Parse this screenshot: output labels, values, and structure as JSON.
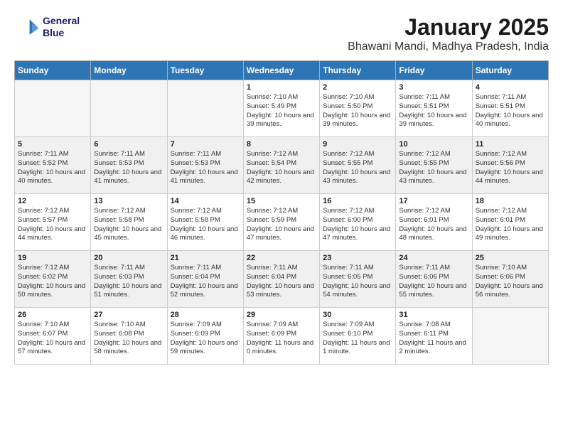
{
  "header": {
    "logo_line1": "General",
    "logo_line2": "Blue",
    "month": "January 2025",
    "location": "Bhawani Mandi, Madhya Pradesh, India"
  },
  "weekdays": [
    "Sunday",
    "Monday",
    "Tuesday",
    "Wednesday",
    "Thursday",
    "Friday",
    "Saturday"
  ],
  "weeks": [
    [
      {
        "day": "",
        "text": "",
        "empty": true
      },
      {
        "day": "",
        "text": "",
        "empty": true
      },
      {
        "day": "",
        "text": "",
        "empty": true
      },
      {
        "day": "1",
        "text": "Sunrise: 7:10 AM\nSunset: 5:49 PM\nDaylight: 10 hours\nand 39 minutes."
      },
      {
        "day": "2",
        "text": "Sunrise: 7:10 AM\nSunset: 5:50 PM\nDaylight: 10 hours\nand 39 minutes."
      },
      {
        "day": "3",
        "text": "Sunrise: 7:11 AM\nSunset: 5:51 PM\nDaylight: 10 hours\nand 39 minutes."
      },
      {
        "day": "4",
        "text": "Sunrise: 7:11 AM\nSunset: 5:51 PM\nDaylight: 10 hours\nand 40 minutes."
      }
    ],
    [
      {
        "day": "5",
        "text": "Sunrise: 7:11 AM\nSunset: 5:52 PM\nDaylight: 10 hours\nand 40 minutes."
      },
      {
        "day": "6",
        "text": "Sunrise: 7:11 AM\nSunset: 5:53 PM\nDaylight: 10 hours\nand 41 minutes."
      },
      {
        "day": "7",
        "text": "Sunrise: 7:11 AM\nSunset: 5:53 PM\nDaylight: 10 hours\nand 41 minutes."
      },
      {
        "day": "8",
        "text": "Sunrise: 7:12 AM\nSunset: 5:54 PM\nDaylight: 10 hours\nand 42 minutes."
      },
      {
        "day": "9",
        "text": "Sunrise: 7:12 AM\nSunset: 5:55 PM\nDaylight: 10 hours\nand 43 minutes."
      },
      {
        "day": "10",
        "text": "Sunrise: 7:12 AM\nSunset: 5:55 PM\nDaylight: 10 hours\nand 43 minutes."
      },
      {
        "day": "11",
        "text": "Sunrise: 7:12 AM\nSunset: 5:56 PM\nDaylight: 10 hours\nand 44 minutes."
      }
    ],
    [
      {
        "day": "12",
        "text": "Sunrise: 7:12 AM\nSunset: 5:57 PM\nDaylight: 10 hours\nand 44 minutes."
      },
      {
        "day": "13",
        "text": "Sunrise: 7:12 AM\nSunset: 5:58 PM\nDaylight: 10 hours\nand 45 minutes."
      },
      {
        "day": "14",
        "text": "Sunrise: 7:12 AM\nSunset: 5:58 PM\nDaylight: 10 hours\nand 46 minutes."
      },
      {
        "day": "15",
        "text": "Sunrise: 7:12 AM\nSunset: 5:59 PM\nDaylight: 10 hours\nand 47 minutes."
      },
      {
        "day": "16",
        "text": "Sunrise: 7:12 AM\nSunset: 6:00 PM\nDaylight: 10 hours\nand 47 minutes."
      },
      {
        "day": "17",
        "text": "Sunrise: 7:12 AM\nSunset: 6:01 PM\nDaylight: 10 hours\nand 48 minutes."
      },
      {
        "day": "18",
        "text": "Sunrise: 7:12 AM\nSunset: 6:01 PM\nDaylight: 10 hours\nand 49 minutes."
      }
    ],
    [
      {
        "day": "19",
        "text": "Sunrise: 7:12 AM\nSunset: 6:02 PM\nDaylight: 10 hours\nand 50 minutes."
      },
      {
        "day": "20",
        "text": "Sunrise: 7:11 AM\nSunset: 6:03 PM\nDaylight: 10 hours\nand 51 minutes."
      },
      {
        "day": "21",
        "text": "Sunrise: 7:11 AM\nSunset: 6:04 PM\nDaylight: 10 hours\nand 52 minutes."
      },
      {
        "day": "22",
        "text": "Sunrise: 7:11 AM\nSunset: 6:04 PM\nDaylight: 10 hours\nand 53 minutes."
      },
      {
        "day": "23",
        "text": "Sunrise: 7:11 AM\nSunset: 6:05 PM\nDaylight: 10 hours\nand 54 minutes."
      },
      {
        "day": "24",
        "text": "Sunrise: 7:11 AM\nSunset: 6:06 PM\nDaylight: 10 hours\nand 55 minutes."
      },
      {
        "day": "25",
        "text": "Sunrise: 7:10 AM\nSunset: 6:06 PM\nDaylight: 10 hours\nand 56 minutes."
      }
    ],
    [
      {
        "day": "26",
        "text": "Sunrise: 7:10 AM\nSunset: 6:07 PM\nDaylight: 10 hours\nand 57 minutes."
      },
      {
        "day": "27",
        "text": "Sunrise: 7:10 AM\nSunset: 6:08 PM\nDaylight: 10 hours\nand 58 minutes."
      },
      {
        "day": "28",
        "text": "Sunrise: 7:09 AM\nSunset: 6:09 PM\nDaylight: 10 hours\nand 59 minutes."
      },
      {
        "day": "29",
        "text": "Sunrise: 7:09 AM\nSunset: 6:09 PM\nDaylight: 11 hours\nand 0 minutes."
      },
      {
        "day": "30",
        "text": "Sunrise: 7:09 AM\nSunset: 6:10 PM\nDaylight: 11 hours\nand 1 minute."
      },
      {
        "day": "31",
        "text": "Sunrise: 7:08 AM\nSunset: 6:11 PM\nDaylight: 11 hours\nand 2 minutes."
      },
      {
        "day": "",
        "text": "",
        "empty": true
      }
    ]
  ]
}
